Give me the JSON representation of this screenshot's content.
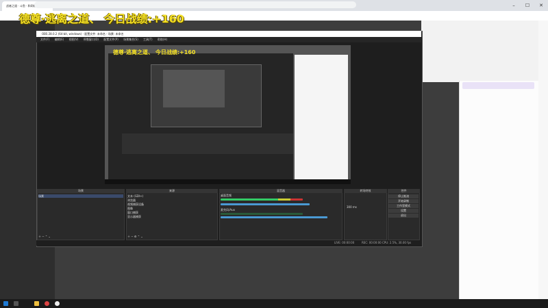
{
  "browser": {
    "tab_title": "战者之道 · 斗鱼 · 和网络直播哪…",
    "controls": [
      "–",
      "☐",
      "✕"
    ]
  },
  "overlay_text": "德尊·逃离之道、  今日战绩:+160",
  "obs": {
    "title": "OBS 28.0.2 (64-bit, windows) - 配置文件: 未命名 - 场景: 未命名",
    "menu": [
      "文件(F)",
      "编辑(E)",
      "视图(V)",
      "停靠窗口(D)",
      "配置文件(P)",
      "场景集合(S)",
      "工具(T)",
      "帮助(H)"
    ],
    "docks": {
      "scenes": {
        "title": "场景",
        "items": [
          "场景"
        ]
      },
      "sources": {
        "title": "来源",
        "items": [
          "文本 (GDI+)",
          "浏览器",
          "视频捕获设备",
          "图像",
          "窗口捕获",
          "显示器捕获"
        ]
      },
      "mixer": {
        "title": "混音器",
        "tracks": [
          "桌面音频",
          "麦克风/Aux"
        ]
      },
      "transitions": {
        "title": "转场特效",
        "duration": "300 ms"
      },
      "controls": {
        "title": "控件",
        "buttons": [
          "停止推流",
          "开始录制",
          "工作室模式",
          "设置",
          "退出"
        ]
      }
    },
    "status": {
      "live": "LIVE: 00:00:00",
      "rec": "REC: 00:00:00",
      "cpu": "CPU: 2.5%, 30.00 fps"
    }
  }
}
